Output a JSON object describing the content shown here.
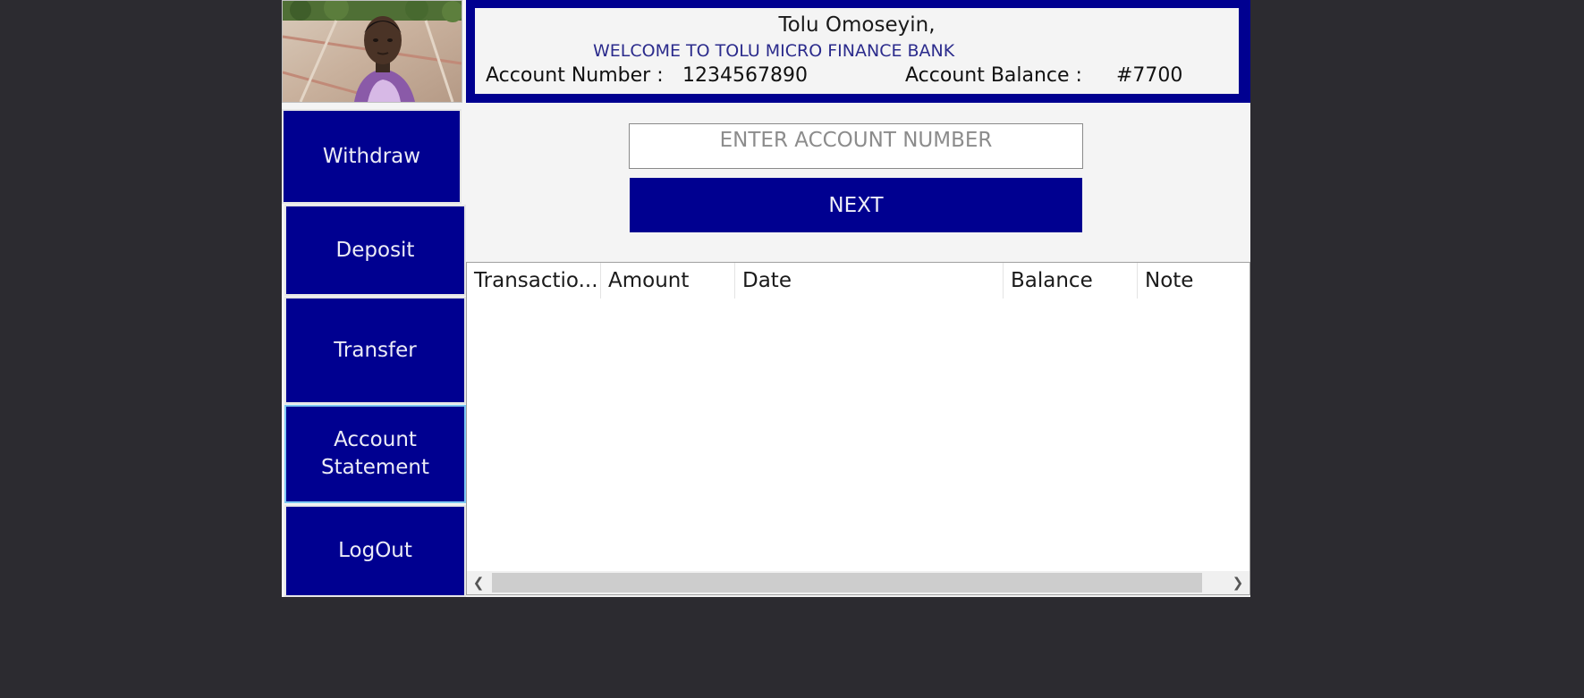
{
  "header": {
    "user_name": "Tolu Omoseyin,",
    "welcome": "WELCOME TO TOLU MICRO FINANCE BANK",
    "account_number_label": "Account Number :",
    "account_number": "1234567890",
    "account_balance_label": "Account Balance :",
    "account_balance": "#7700"
  },
  "sidebar": {
    "items": [
      {
        "label": "Withdraw"
      },
      {
        "label": "Deposit"
      },
      {
        "label": "Transfer"
      },
      {
        "label": "Account\nStatement"
      },
      {
        "label": "LogOut"
      }
    ]
  },
  "form": {
    "account_input_placeholder": "ENTER ACCOUNT NUMBER",
    "account_input_value": "",
    "next_label": "NEXT"
  },
  "table": {
    "columns": [
      "Transactio...",
      "Amount",
      "Date",
      "Balance",
      "Note"
    ],
    "rows": []
  },
  "colors": {
    "primary": "#000090",
    "background": "#2c2b30",
    "panel": "#f4f4f4",
    "focus_border": "#7ec8f2"
  },
  "icons": {
    "scroll_left": "chevron-left-icon",
    "scroll_right": "chevron-right-icon"
  }
}
